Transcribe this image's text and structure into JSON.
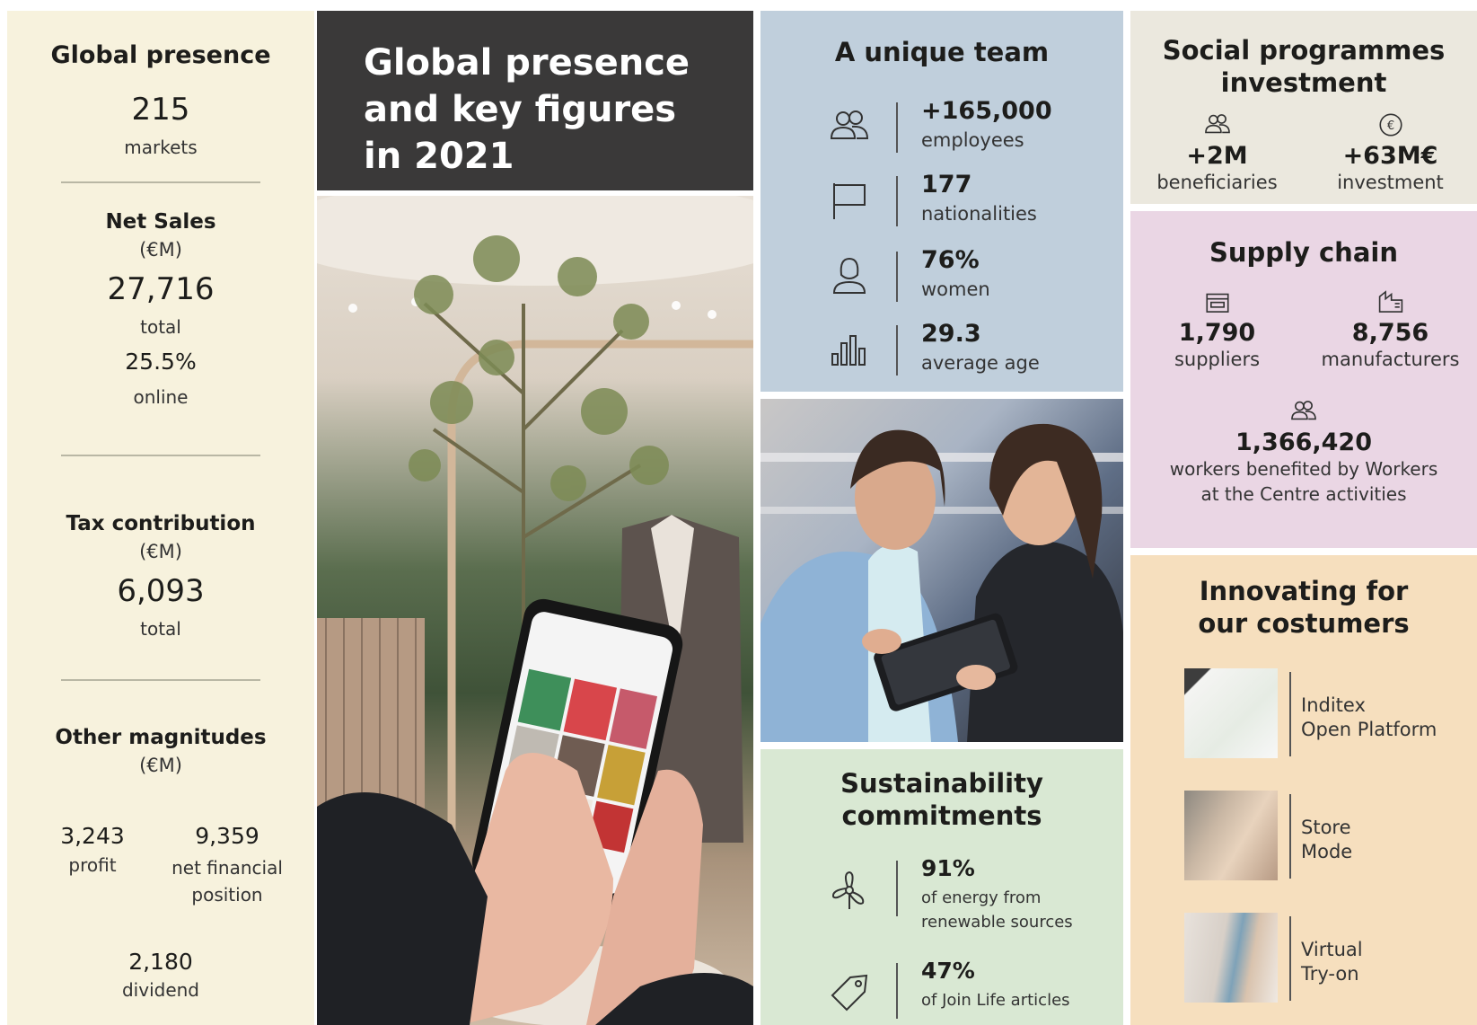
{
  "col1": {
    "title": "Global presence",
    "markets_value": "215",
    "markets_label": "markets",
    "net_sales_title": "Net Sales",
    "net_sales_unit": "(€M)",
    "net_sales_value": "27,716",
    "net_sales_label": "total",
    "online_value": "25.5%",
    "online_label": "online",
    "tax_title": "Tax contribution",
    "tax_unit": "(€M)",
    "tax_value": "6,093",
    "tax_label": "total",
    "other_title": "Other magnitudes",
    "other_unit": "(€M)",
    "profit_value": "3,243",
    "profit_label": "profit",
    "nfp_value": "9,359",
    "nfp_label_1": "net financial",
    "nfp_label_2": "position",
    "dividend_value": "2,180",
    "dividend_label": "dividend"
  },
  "col2": {
    "title_lines": [
      "Global presence",
      "and key figures",
      "in 2021"
    ]
  },
  "team": {
    "title": "A unique team",
    "rows": [
      {
        "icon": "people-icon",
        "value": "+165,000",
        "label": "employees"
      },
      {
        "icon": "flag-icon",
        "value": "177",
        "label": "nationalities"
      },
      {
        "icon": "woman-icon",
        "value": "76%",
        "label": "women"
      },
      {
        "icon": "bar-chart-icon",
        "value": "29.3",
        "label": "average age"
      }
    ]
  },
  "sustainability": {
    "title_lines": [
      "Sustainability",
      "commitments"
    ],
    "rows": [
      {
        "icon": "wind-turbine-icon",
        "value": "91%",
        "label_lines": [
          "of energy from",
          "renewable sources"
        ]
      },
      {
        "icon": "tag-icon",
        "value": "47%",
        "label_lines": [
          "of Join Life articles"
        ]
      }
    ]
  },
  "social": {
    "title_lines": [
      "Social programmes",
      "investment"
    ],
    "left": {
      "icon": "people-icon",
      "value": "+2M",
      "label": "beneficiaries"
    },
    "right": {
      "icon": "euro-coin-icon",
      "value": "+63M€",
      "label": "investment"
    }
  },
  "supply": {
    "title": "Supply chain",
    "left": {
      "icon": "store-icon",
      "value": "1,790",
      "label": "suppliers"
    },
    "right": {
      "icon": "factory-icon",
      "value": "8,756",
      "label": "manufacturers"
    },
    "workers": {
      "icon": "people-icon",
      "value": "1,366,420",
      "label_lines": [
        "workers benefited by Workers",
        "at the Centre activities"
      ]
    }
  },
  "innovation": {
    "title_lines": [
      "Innovating for",
      "our costumers"
    ],
    "items": [
      {
        "label_lines": [
          "Inditex",
          "Open Platform"
        ]
      },
      {
        "label_lines": [
          "Store",
          "Mode"
        ]
      },
      {
        "label_lines": [
          "Virtual",
          "Try-on"
        ]
      }
    ]
  },
  "colors": {
    "col1_bg": "#f7f2dd",
    "title_bg": "#3a3939",
    "team_bg": "#c0cfdc",
    "sustainability_bg": "#d9e8d3",
    "social_bg": "#ebe8de",
    "supply_bg": "#ead6e4",
    "innovation_bg": "#f6dfbe"
  }
}
